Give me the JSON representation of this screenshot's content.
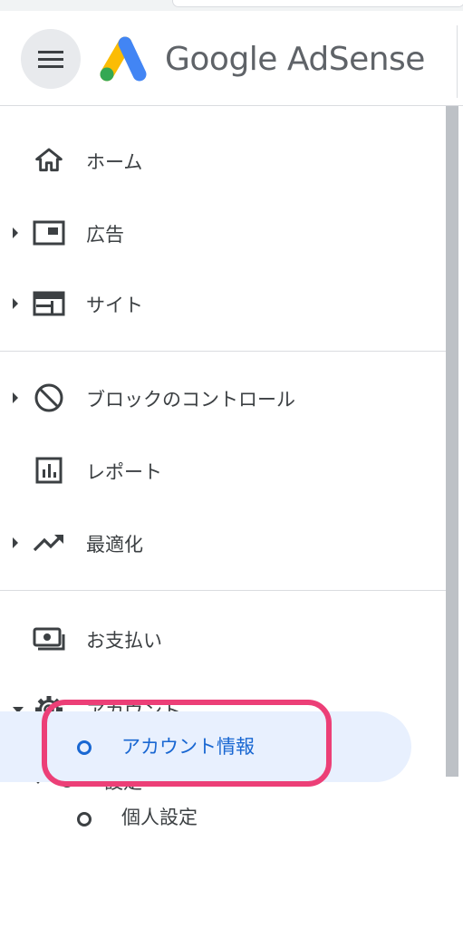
{
  "header": {
    "brand": "Google AdSense",
    "menu_icon": "hamburger-icon",
    "logo_icon": "adsense-logo-icon"
  },
  "nav": {
    "items": [
      {
        "label": "ホーム",
        "icon": "home-icon",
        "expandable": false
      },
      {
        "label": "広告",
        "icon": "ads-icon",
        "expandable": true
      },
      {
        "label": "サイト",
        "icon": "sites-icon",
        "expandable": true
      },
      {
        "label": "ブロックのコントロール",
        "icon": "block-icon",
        "expandable": true
      },
      {
        "label": "レポート",
        "icon": "report-icon",
        "expandable": false
      },
      {
        "label": "最適化",
        "icon": "trending-icon",
        "expandable": true
      },
      {
        "label": "お支払い",
        "icon": "payments-icon",
        "expandable": false
      },
      {
        "label": "アカウント",
        "icon": "gear-icon",
        "expandable": true,
        "expanded": true
      }
    ],
    "settings": {
      "label": "設定",
      "expanded": true
    },
    "settings_children": [
      {
        "label": "アカウント情報",
        "active": true
      },
      {
        "label": "個人設定",
        "active": false
      }
    ]
  },
  "colors": {
    "active_bg": "#e8f0fe",
    "active_text": "#1967d2",
    "highlight": "#ec3f77"
  }
}
